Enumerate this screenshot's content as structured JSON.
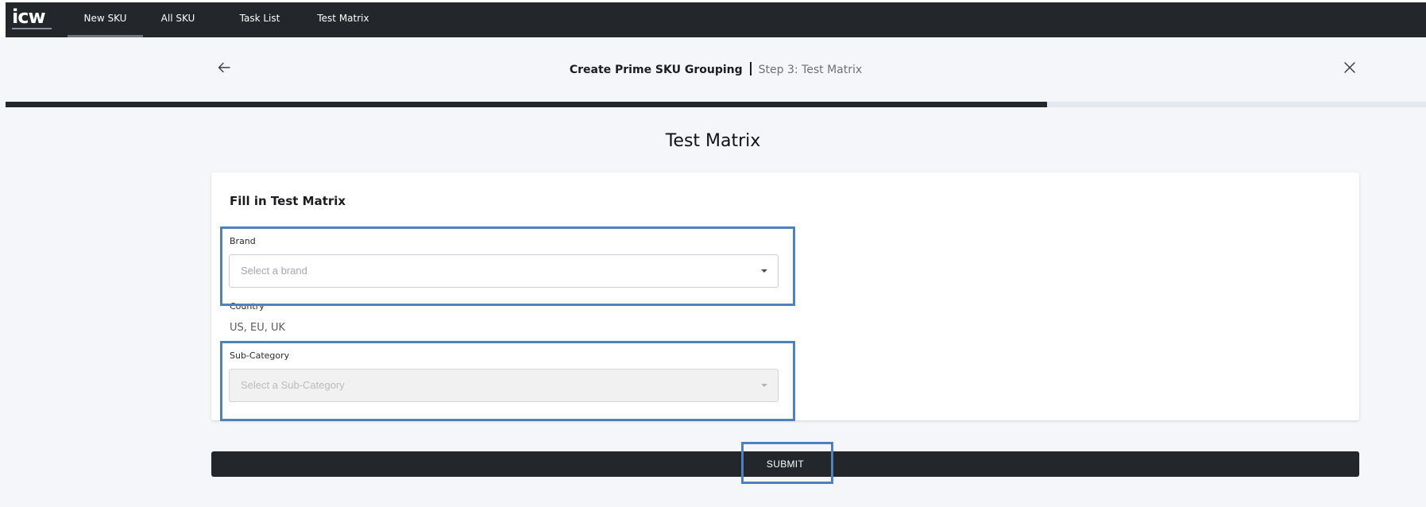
{
  "app": {
    "logo_text": "icw",
    "nav": [
      {
        "label": "New SKU",
        "active": true
      },
      {
        "label": "All SKU",
        "active": false
      },
      {
        "label": "Task List",
        "active": false
      },
      {
        "label": "Test Matrix",
        "active": false
      }
    ]
  },
  "header": {
    "title": "Create Prime SKU Grouping",
    "step": "Step 3: Test Matrix",
    "back_icon": "arrow-left-icon",
    "close_icon": "close-icon"
  },
  "progress": {
    "fraction": 0.733,
    "fill_color": "#23262b",
    "track_color": "#e3e7ef"
  },
  "page": {
    "title": "Test Matrix"
  },
  "form": {
    "title": "Fill in Test Matrix",
    "brand": {
      "label": "Brand",
      "placeholder": "Select a brand"
    },
    "country": {
      "label": "Country",
      "value": "US, EU, UK"
    },
    "subcategory": {
      "label": "Sub-Category",
      "placeholder": "Select a Sub-Category",
      "disabled": true
    }
  },
  "actions": {
    "submit_label": "SUBMIT"
  },
  "colors": {
    "highlight": "#4f81bd",
    "dark": "#23262b"
  }
}
